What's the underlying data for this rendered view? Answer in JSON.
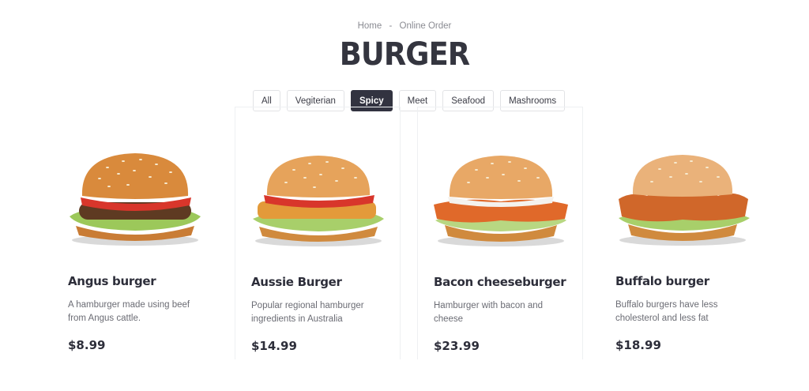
{
  "breadcrumb": {
    "home": "Home",
    "separator": "-",
    "current": "Online Order"
  },
  "page_title": "BURGER",
  "filters": [
    {
      "label": "All",
      "active": false
    },
    {
      "label": "Vegiterian",
      "active": false
    },
    {
      "label": "Spicy",
      "active": true
    },
    {
      "label": "Meet",
      "active": false
    },
    {
      "label": "Seafood",
      "active": false
    },
    {
      "label": "Mashrooms",
      "active": false
    }
  ],
  "products": [
    {
      "name": "Angus burger",
      "description": "A hamburger made using beef from Angus cattle.",
      "price": "$8.99",
      "image": "angus-burger-image"
    },
    {
      "name": "Aussie Burger",
      "description": "Popular regional hamburger ingredients in Australia",
      "price": "$14.99",
      "image": "aussie-burger-image"
    },
    {
      "name": "Bacon cheeseburger",
      "description": "Hamburger with bacon and cheese",
      "price": "$23.99",
      "image": "bacon-cheeseburger-image"
    },
    {
      "name": "Buffalo burger",
      "description": "Buffalo burgers have less cholesterol and less fat",
      "price": "$18.99",
      "image": "buffalo-burger-image"
    }
  ],
  "colors": {
    "primary_dark": "#323340",
    "text": "#2d2e3a",
    "muted": "#8a8b92"
  }
}
